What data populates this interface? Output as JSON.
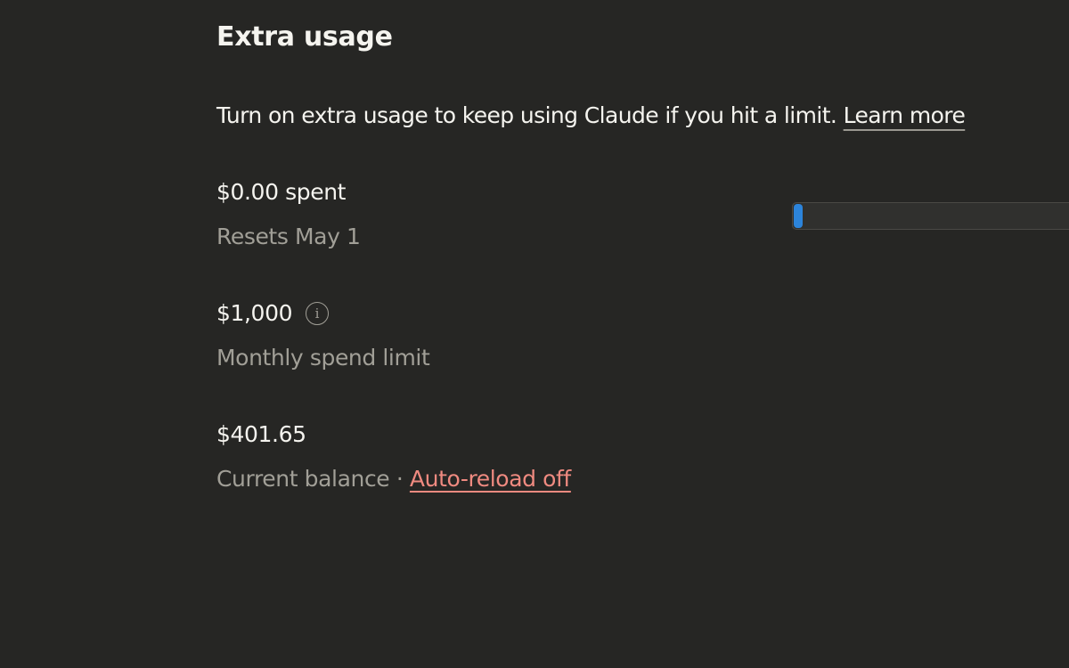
{
  "section": {
    "title": "Extra usage",
    "description": "Turn on extra usage to keep using Claude if you hit a limit.",
    "learn_more_label": "Learn more"
  },
  "spent": {
    "value": "$0.00 spent",
    "reset_text": "Resets May 1",
    "progress_percent": 0
  },
  "limit": {
    "value": "$1,000",
    "label": "Monthly spend limit",
    "icon": "info-icon"
  },
  "balance": {
    "value": "$401.65",
    "label": "Current balance",
    "separator": "·",
    "auto_reload_label": "Auto-reload off"
  },
  "colors": {
    "background": "#262624",
    "text_primary": "#f5f4ef",
    "text_secondary": "#a19f97",
    "progress_fill": "#2c84db",
    "link_danger": "#ef8a80"
  }
}
